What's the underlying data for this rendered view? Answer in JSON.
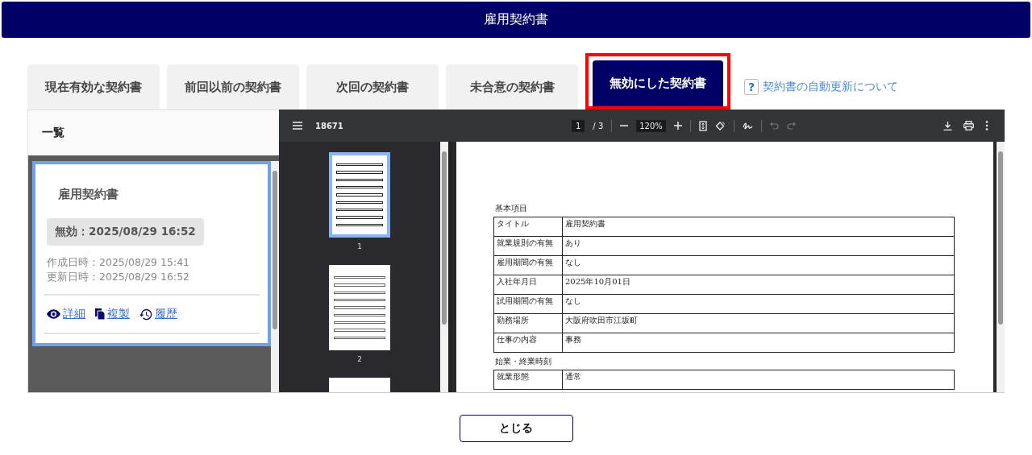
{
  "header": {
    "title": "雇用契約書"
  },
  "tabs": [
    {
      "label": "現在有効な契約書",
      "selected": false,
      "highlighted": false
    },
    {
      "label": "前回以前の契約書",
      "selected": false,
      "highlighted": false
    },
    {
      "label": "次回の契約書",
      "selected": false,
      "highlighted": false
    },
    {
      "label": "未合意の契約書",
      "selected": false,
      "highlighted": false
    },
    {
      "label": "無効にした契約書",
      "selected": true,
      "highlighted": true
    }
  ],
  "help_link": {
    "icon": "?",
    "label": "契約書の自動更新について"
  },
  "list_panel": {
    "title": "一覧",
    "cards": [
      {
        "title": "雇用契約書",
        "status": "無効：2025/08/29 16:52",
        "created": "作成日時：2025/08/29 15:41",
        "updated": "更新日時：2025/08/29 16:52",
        "selected": true,
        "actions": [
          {
            "kind": "view",
            "label": "詳細"
          },
          {
            "kind": "copy",
            "label": "複製"
          },
          {
            "kind": "history",
            "label": "履歴"
          }
        ]
      }
    ]
  },
  "pdf_viewer": {
    "file_name": "18671",
    "page": "1",
    "page_total": "/ 3",
    "zoom": "120%",
    "thumbnails": [
      {
        "label": "1",
        "selected": true
      },
      {
        "label": "2",
        "selected": false
      }
    ],
    "sections": [
      {
        "heading": "基本項目",
        "rows": [
          [
            "タイトル",
            "雇用契約書"
          ],
          [
            "就業規則の有無",
            "あり"
          ],
          [
            "雇用期間の有無",
            "なし"
          ],
          [
            "入社年月日",
            "2025年10月01日"
          ],
          [
            "試用期間の有無",
            "なし"
          ],
          [
            "勤務場所",
            "大阪府吹田市江坂町"
          ],
          [
            "仕事の内容",
            "事務"
          ]
        ]
      },
      {
        "heading": "始業・終業時刻",
        "rows": [
          [
            "就業形態",
            "通常"
          ]
        ]
      }
    ]
  },
  "footer": {
    "close_button": "とじる"
  }
}
